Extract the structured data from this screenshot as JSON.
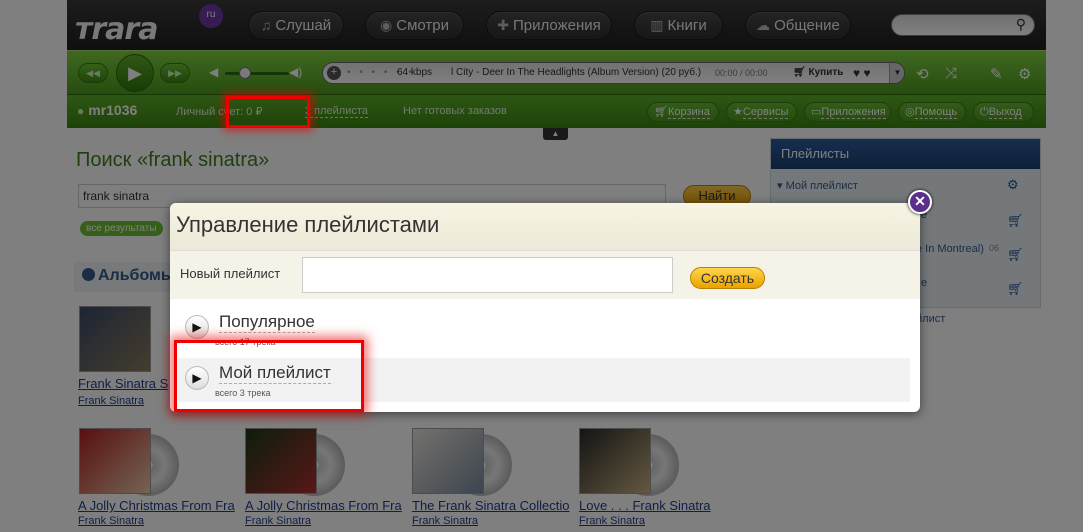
{
  "header": {
    "logo": "тrara",
    "logo_badge": "ru",
    "tabs": [
      {
        "label": "Слушай",
        "icon": "music-note-icon"
      },
      {
        "label": "Смотри",
        "icon": "eye-icon"
      },
      {
        "label": "Приложения",
        "icon": "gamepad-icon"
      },
      {
        "label": "Книги",
        "icon": "book-icon"
      },
      {
        "label": "Общение",
        "icon": "chat-icon"
      }
    ],
    "search_placeholder": ""
  },
  "player": {
    "dots": "• • • • • •",
    "bitrate": "64 kbps",
    "track_title": "l City - Deer In The Headlights (Album Version) (20 руб.)",
    "time": "00:00 / 00:00",
    "buy_label": "Купить"
  },
  "userbar": {
    "username": "mr1036",
    "account": "Личный счет: 0 ₽",
    "playlists_link": "2 плейлиста",
    "orders": "Нет готовых заказов",
    "buttons": [
      "Корзина",
      "Сервисы",
      "Приложения",
      "Помощь",
      "Выход"
    ]
  },
  "search": {
    "title": "Поиск «frank sinatra»",
    "query": "frank sinatra",
    "find_button": "Найти",
    "all_results": "все результаты",
    "albums_heading": "Альбомы"
  },
  "albums": [
    {
      "title": "Frank Sinatra S",
      "artist": "Frank Sinatra"
    },
    {
      "title": "A Jolly Christmas From Fra",
      "artist": "Frank Sinatra"
    },
    {
      "title": "A Jolly Christmas From Fra",
      "artist": "Frank Sinatra"
    },
    {
      "title": "The Frank Sinatra Collectio",
      "artist": "Frank Sinatra"
    },
    {
      "title": "Love . . . Frank Sinatra",
      "artist": "Frank Sinatra"
    }
  ],
  "sidebar": {
    "title": "Плейлисты",
    "current": "Мой плейлист",
    "frag1": "e",
    "frag2": "e In Montreal)",
    "frag2_time": "06",
    "frag3": "e",
    "frag4": "йлист"
  },
  "modal": {
    "title": "Управление плейлистами",
    "new_label": "Новый плейлист",
    "new_value": "",
    "create_button": "Создать",
    "playlists": [
      {
        "name": "Популярное",
        "count": "всего 17 трека"
      },
      {
        "name": "Мой плейлист",
        "count": "всего 3 трека"
      }
    ]
  },
  "colors": {
    "accent_green": "#5cad27",
    "highlight": "#e00000",
    "modal_close": "#5a2f8a"
  }
}
